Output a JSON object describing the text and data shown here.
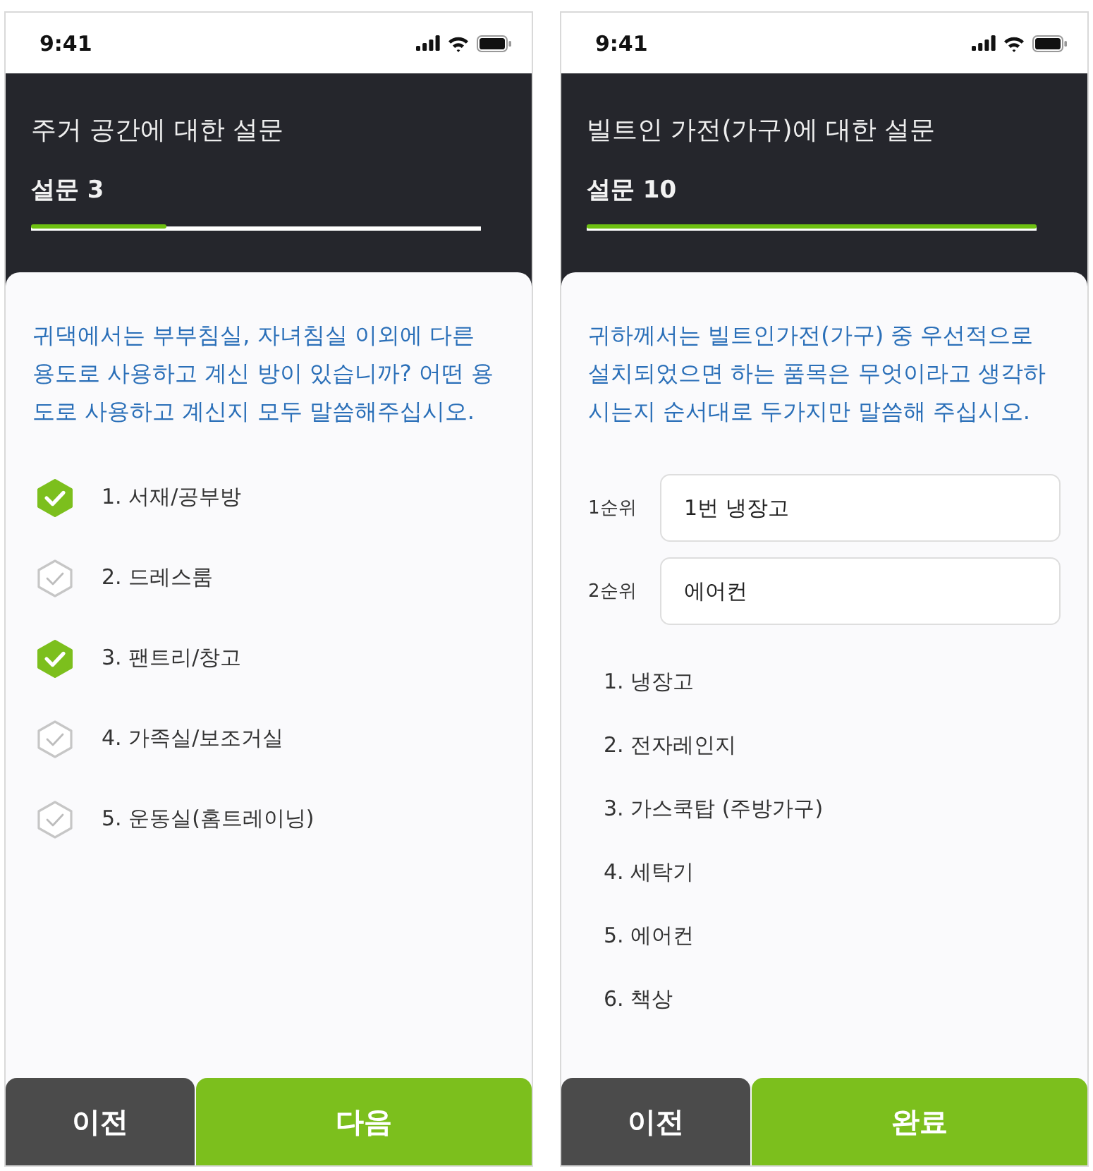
{
  "screens": [
    {
      "kind": "multiple_choice",
      "status_bar": {
        "time": "9:41"
      },
      "header": {
        "title": "주거 공간에 대한 설문",
        "step": "설문 3",
        "progress": {
          "level": 0.3
        }
      },
      "question": "귀댁에서는 부부침실, 자녀침실 이외에 다른 용도로 사용하고 계신 방이 있습니까? 어떤 용도로 사용하고 계신지 모두 말씀해주십시오.",
      "options": [
        {
          "label": "1. 서재/공부방",
          "checked": true
        },
        {
          "label": "2. 드레스룸",
          "checked": false
        },
        {
          "label": "3. 팬트리/창고",
          "checked": true
        },
        {
          "label": "4. 가족실/보조거실",
          "checked": false
        },
        {
          "label": "5. 운동실(홈트레이닝)",
          "checked": false
        }
      ],
      "buttons": [
        {
          "label": "이전",
          "kind": "secondary"
        },
        {
          "label": "다음",
          "kind": "primary"
        }
      ]
    },
    {
      "kind": "ranking",
      "status_bar": {
        "time": "9:41"
      },
      "header": {
        "title": "빌트인 가전(가구)에 대한 설문",
        "step": "설문 10",
        "progress": {
          "level": 1
        }
      },
      "question": "귀하께서는 빌트인가전(가구) 중 우선적으로 설치되었으면 하는 품목은 무엇이라고 생각하시는지 순서대로 두가지만 말씀해 주십시오.",
      "rank_fields": [
        {
          "label": "1순위",
          "value": "1번 냉장고"
        },
        {
          "label": "2순위",
          "value": "에어컨"
        }
      ],
      "options": [
        {
          "label": "1. 냉장고"
        },
        {
          "label": "2. 전자레인지"
        },
        {
          "label": "3. 가스쿡탑 (주방가구)"
        },
        {
          "label": "4. 세탁기"
        },
        {
          "label": "5. 에어컨"
        },
        {
          "label": "6. 책상"
        }
      ],
      "buttons": [
        {
          "label": "이전",
          "kind": "secondary"
        },
        {
          "label": "완료",
          "kind": "primary"
        }
      ]
    }
  ]
}
